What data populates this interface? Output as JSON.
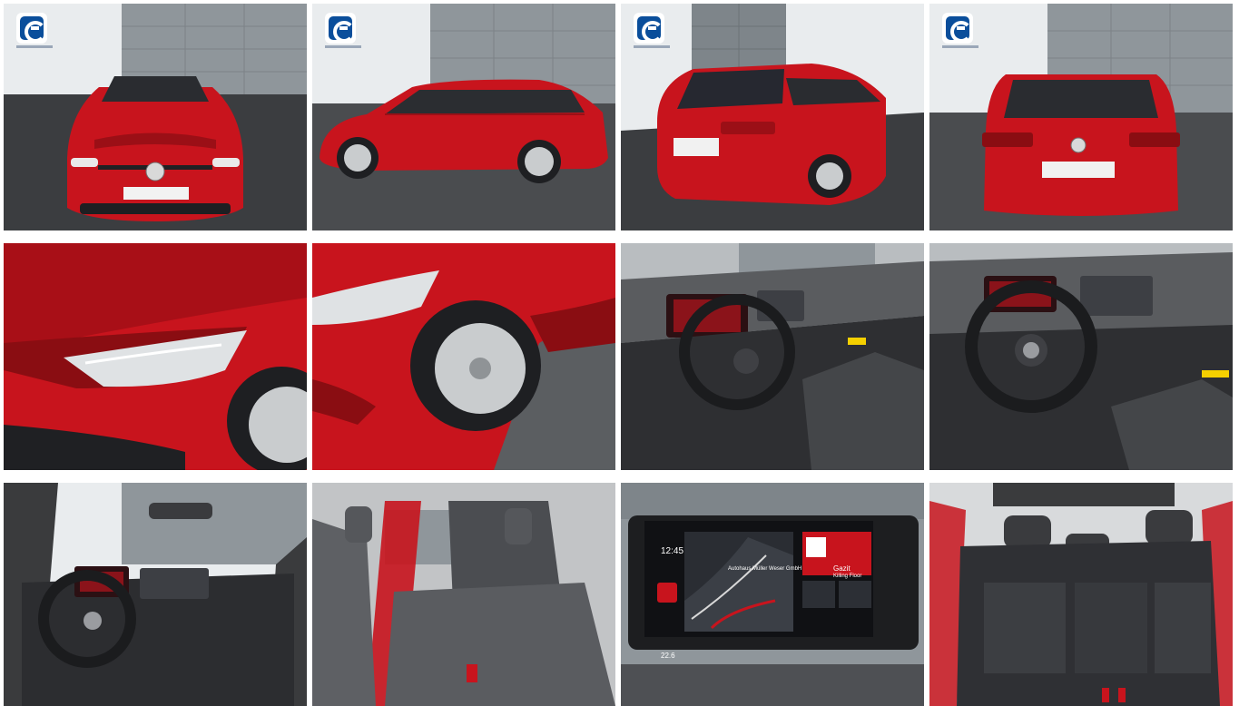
{
  "colors": {
    "paint": "#c8141d",
    "paint_dark": "#8a0d12",
    "wall": "#8f969b",
    "floor": "#3b3d40",
    "interior": "#3a3b3d",
    "dealer_blue": "#0a4e9b"
  },
  "icons": {
    "dealer_logo": "dealer-logo-icon",
    "vw_badge": "vw-badge-icon"
  },
  "infotainment": {
    "time": "12:45",
    "temp": "22.6",
    "poi": "Autohaus Müller Weser GmbH",
    "media_title": "Gazit",
    "media_sub": "Killing Floor"
  },
  "tiles": [
    {
      "id": "front"
    },
    {
      "id": "side"
    },
    {
      "id": "rear-three-quarter"
    },
    {
      "id": "rear"
    },
    {
      "id": "headlight-detail"
    },
    {
      "id": "wheel-detail"
    },
    {
      "id": "cockpit-left"
    },
    {
      "id": "cockpit-center"
    },
    {
      "id": "dashboard-wide"
    },
    {
      "id": "rear-seats-side"
    },
    {
      "id": "infotainment-screen"
    },
    {
      "id": "rear-bench"
    }
  ]
}
